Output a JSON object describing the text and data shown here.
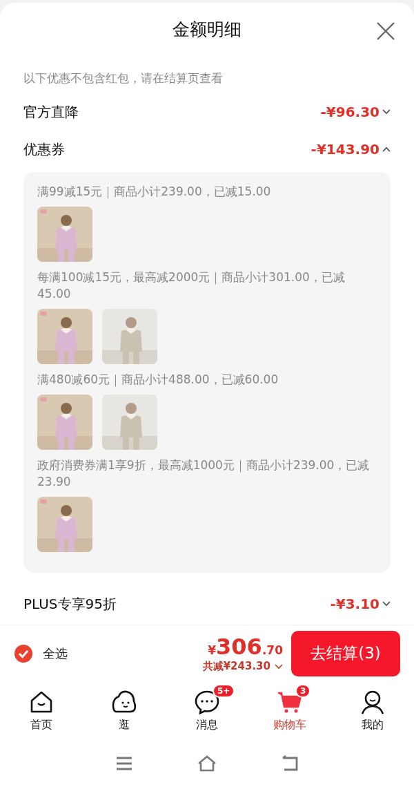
{
  "sheet": {
    "title": "金额明细",
    "note": "以下优惠不包含红包，请在结算页查看"
  },
  "discounts": [
    {
      "label": "官方直降",
      "amount": "-¥96.30",
      "expanded": false
    },
    {
      "label": "优惠券",
      "amount": "-¥143.90",
      "expanded": true,
      "coupons": [
        {
          "text": "满99减15元｜商品小计239.00，已减15.00"
        },
        {
          "text": "每满100减15元，最高减2000元｜商品小计301.00，已减45.00"
        },
        {
          "text": "满480减60元｜商品小计488.00，已减60.00"
        },
        {
          "text": "政府消费券满1享9折，最高减1000元｜商品小计239.00，已减23.90"
        }
      ]
    },
    {
      "label": "PLUS专享95折",
      "amount": "-¥3.10",
      "expanded": false
    }
  ],
  "checkout": {
    "select_all": {
      "label": "全选",
      "checked": true
    },
    "price_symbol": "¥",
    "price_int": "306",
    "price_dec": ".70",
    "saved": "共减¥243.30",
    "button": "去结算(3)"
  },
  "tabs": [
    {
      "label": "首页",
      "kind": "home",
      "selected": false
    },
    {
      "label": "逛",
      "kind": "browse",
      "selected": false
    },
    {
      "label": "消息",
      "kind": "messages",
      "selected": false,
      "badge": "5+"
    },
    {
      "label": "购物车",
      "kind": "cart",
      "selected": true,
      "badge": "3"
    },
    {
      "label": "我的",
      "kind": "profile",
      "selected": false
    }
  ]
}
